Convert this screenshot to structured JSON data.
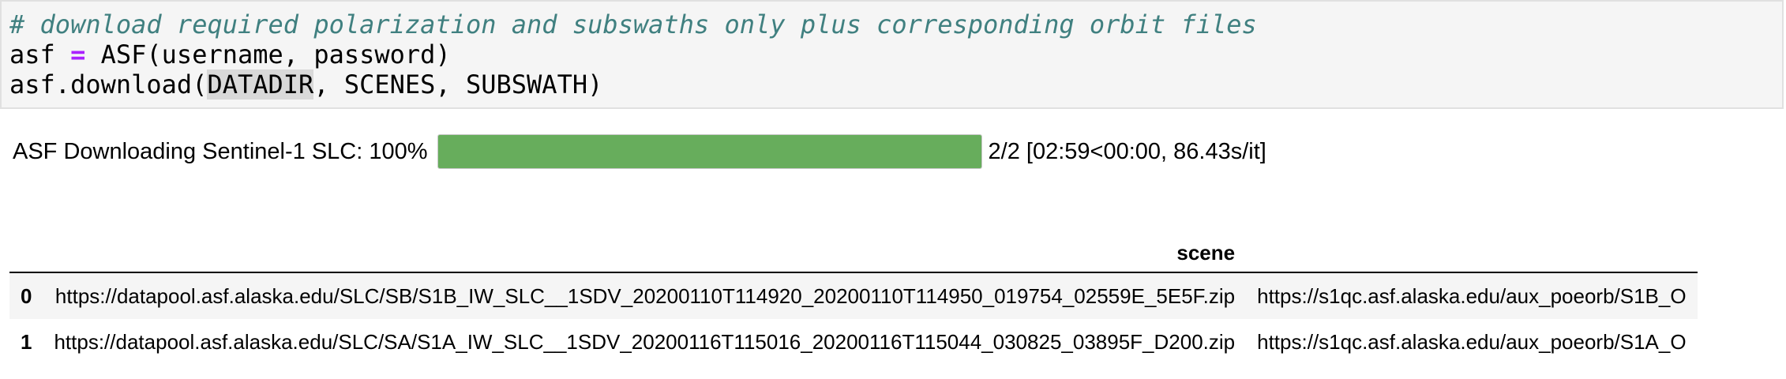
{
  "code_cell": {
    "line1_comment": "# download required polarization and subswaths only plus corresponding orbit files",
    "line2_var": "asf",
    "line2_op": "=",
    "line2_rest": "ASF(username, password)",
    "line3_prefix": "asf.download(",
    "line3_highlight": "DATADIR",
    "line3_suffix": ", SCENES, SUBSWATH)"
  },
  "progress": {
    "label": "ASF Downloading Sentinel-1 SLC: 100%",
    "fraction": 1.0,
    "status": "2/2 [02:59<00:00, 86.43s/it]",
    "fill_color": "#67ad5c"
  },
  "table": {
    "columns": [
      "",
      "scene",
      ""
    ],
    "rows": [
      {
        "index": "0",
        "scene": "https://datapool.asf.alaska.edu/SLC/SB/S1B_IW_SLC__1SDV_20200110T114920_20200110T114950_019754_02559E_5E5F.zip",
        "orbit": "https://s1qc.asf.alaska.edu/aux_poeorb/S1B_O"
      },
      {
        "index": "1",
        "scene": "https://datapool.asf.alaska.edu/SLC/SA/S1A_IW_SLC__1SDV_20200116T115016_20200116T115044_030825_03895F_D200.zip",
        "orbit": "https://s1qc.asf.alaska.edu/aux_poeorb/S1A_O"
      }
    ]
  }
}
